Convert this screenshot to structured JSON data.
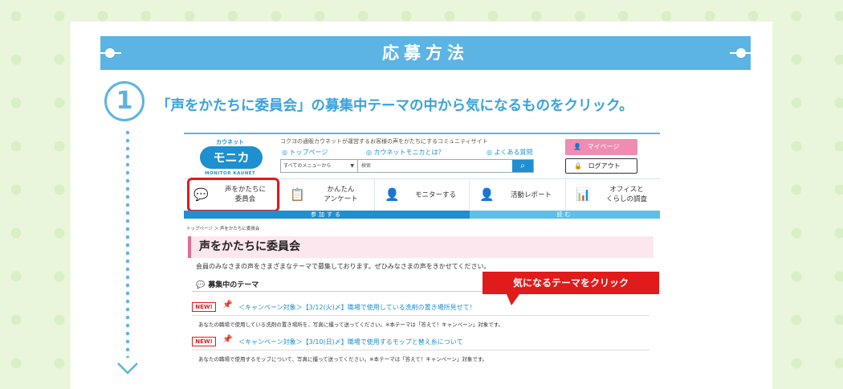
{
  "banner": {
    "title": "応募方法"
  },
  "step": {
    "number": "1",
    "text": "「声をかたちに委員会」の募集中テーマの中から気になるものをクリック。"
  },
  "site": {
    "logo_kana": "カウネット",
    "logo_main": "モニカ",
    "logo_sub": "MONITOR KAUNET",
    "tagline": "コクヨの通販カウネットが運営するお客様の声をかたちにするコミュニティサイト",
    "nav": [
      "トップページ",
      "カウネットモニカとは？",
      "よくある質問"
    ],
    "search": {
      "category": "すべてのメニューから",
      "placeholder": "検索",
      "button": "Q"
    },
    "mypage": "マイページ",
    "logout": "ログアウト",
    "tabs": [
      {
        "label": "声をかたちに 委員会",
        "icon": "chat-bubble-icon"
      },
      {
        "label": "かんたん アンケート",
        "icon": "clipboard-icon"
      },
      {
        "label": "モニターする",
        "icon": "monitor-person-icon"
      },
      {
        "label": "活動レポート",
        "icon": "report-person-icon"
      },
      {
        "label": "オフィスと くらしの調査",
        "icon": "bar-chart-icon"
      }
    ],
    "bar_left": "参加する",
    "bar_right": "読む",
    "breadcrumb": "トップページ ＞ 声をかたちに委員会",
    "page_title": "声をかたちに委員会",
    "intro": "会員のみなさまの声をさまざまなテーマで募集しております。ぜひみなさまの声をきかせてください。",
    "section_title": "募集中のテーマ",
    "callout": "気になるテーマをクリック",
    "items": [
      {
        "badge": "NEW!",
        "title": "＜キャンペーン対象＞【3/12(火)〆】職場で使用している洗剤の置き場所見せて！",
        "desc": "あなたの職場で使用している洗剤の置き場所を、写真に撮って送ってください。※本テーマは「答えて！キャンペーン」対象です。"
      },
      {
        "badge": "NEW!",
        "title": "＜キャンペーン対象＞【3/10(日)〆】職場で使用するモップと替え糸について",
        "desc": "あなたの職場で使用するモップについて、写真に撮って送ってください。※本テーマは「答えて！キャンペーン」対象です。"
      }
    ]
  },
  "colors": {
    "accent": "#5bb4e4",
    "highlight": "#e01b1b",
    "brand": "#1e8fd0",
    "pink": "#f08cb3"
  }
}
